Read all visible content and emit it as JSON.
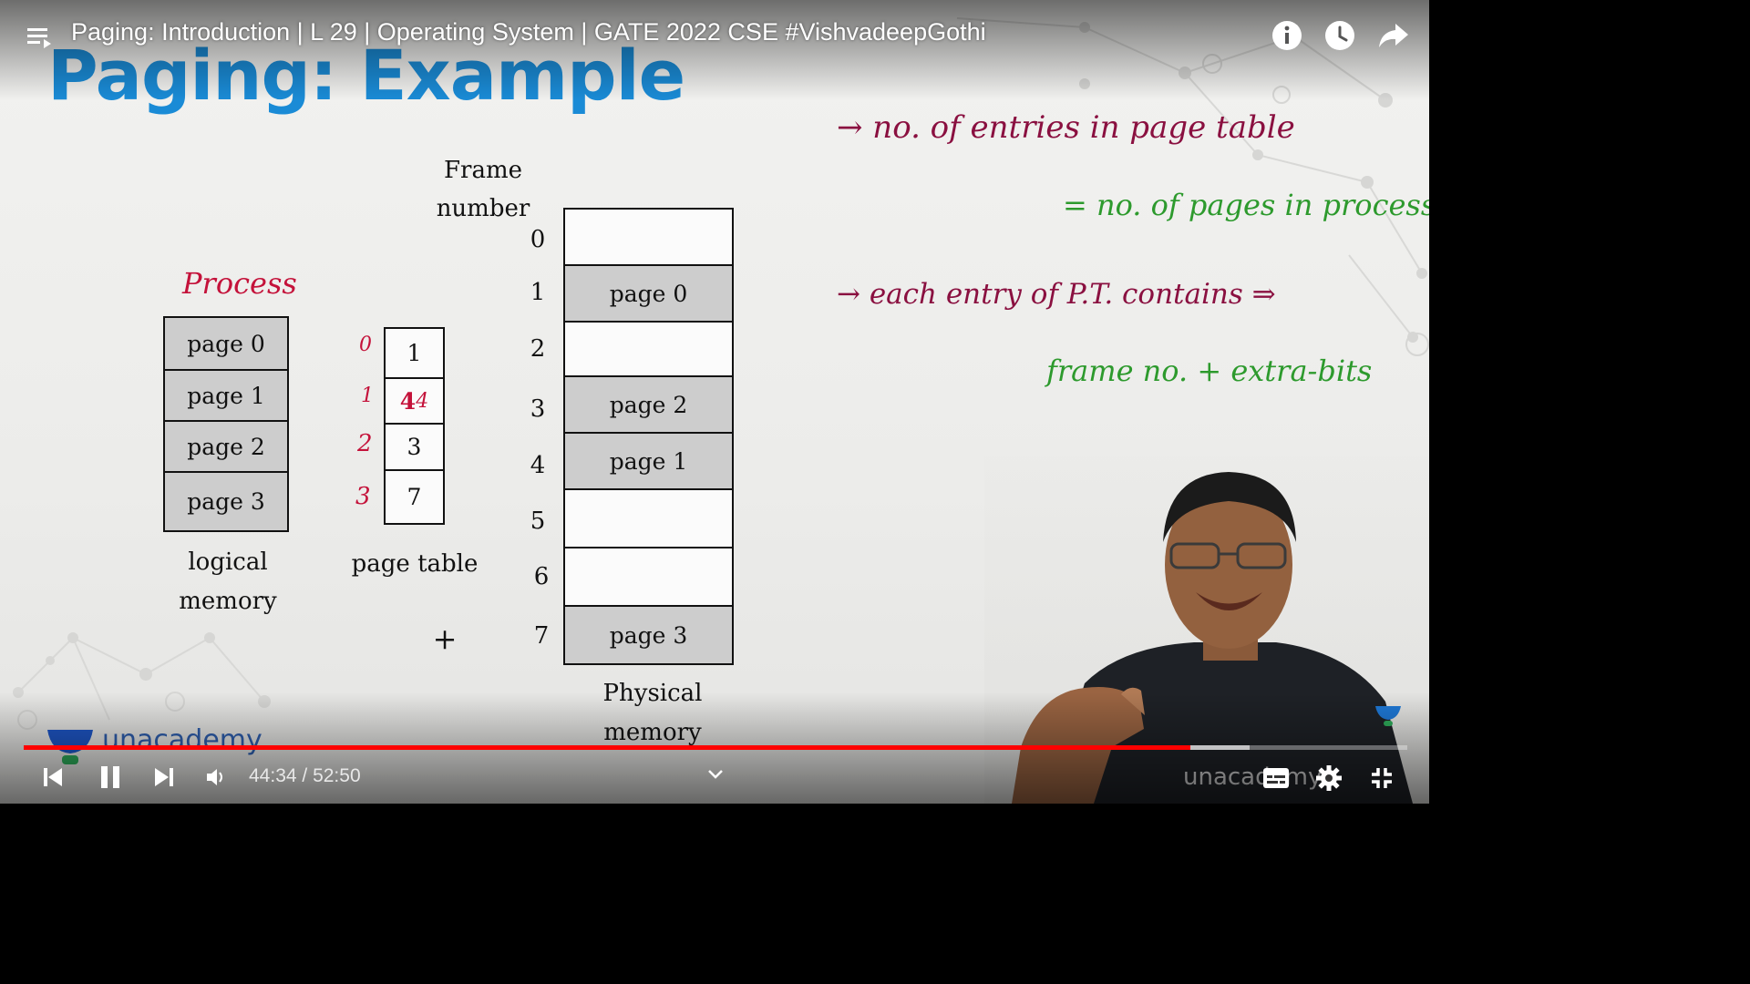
{
  "video": {
    "title": "Paging: Introduction | L 29 | Operating System | GATE 2022 CSE #VishvadeepGothi",
    "time_current": "44:34",
    "time_separator": " / ",
    "time_total": "52:50",
    "progress_fraction": 0.8435,
    "buffered_fraction": 0.886,
    "accent_color": "#ff0000"
  },
  "icons": {
    "playlist": "playlist-icon",
    "info": "info-icon",
    "watch_later": "clock-icon",
    "share": "share-icon",
    "prev": "skip-previous-icon",
    "pause": "pause-icon",
    "next": "skip-next-icon",
    "volume": "volume-icon",
    "chevron": "chevron-down-icon",
    "captions": "captions-icon",
    "settings": "gear-icon",
    "exit_fullscreen": "exit-fullscreen-icon"
  },
  "slide": {
    "title": "Paging: Example",
    "title_color": "#1a8bd6",
    "process_label": "Process",
    "logical_memory": {
      "pages": [
        "page 0",
        "page 1",
        "page 2",
        "page 3"
      ],
      "label_line1": "logical",
      "label_line2": "memory"
    },
    "page_table": {
      "indices": [
        "0",
        "1",
        "2",
        "3"
      ],
      "values": [
        "1",
        "4",
        "3",
        "7"
      ],
      "row1_scribble": "4",
      "label": "page table",
      "plus": "+"
    },
    "frame_header_line1": "Frame",
    "frame_header_line2": "number",
    "physical_memory": {
      "frame_numbers": [
        "0",
        "1",
        "2",
        "3",
        "4",
        "5",
        "6",
        "7"
      ],
      "frames": [
        "",
        "page 0",
        "",
        "page 2",
        "page 1",
        "",
        "",
        "page 3"
      ],
      "label_line1": "Physical",
      "label_line2": "memory"
    },
    "notes": {
      "line1": "→ no. of entries in page table",
      "line2": "= no. of pages in process",
      "line3": "→ each entry of P.T. contains ⇒",
      "line4": "frame no. + extra-bits"
    },
    "brand": "unacademy",
    "watermark": "unacademy"
  }
}
